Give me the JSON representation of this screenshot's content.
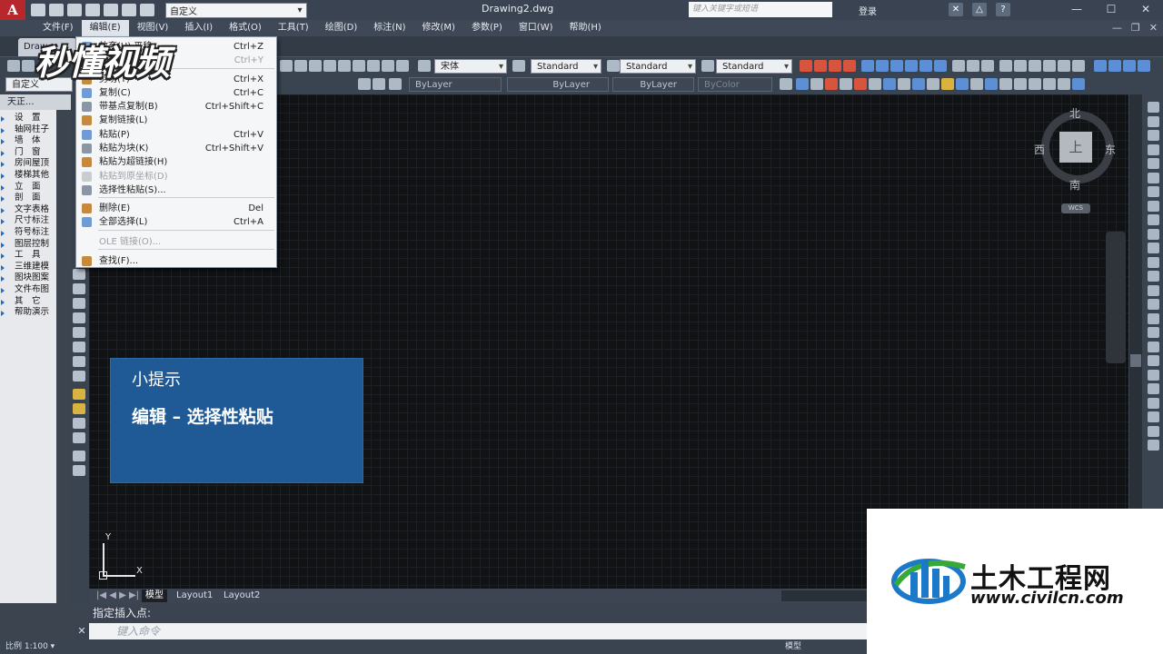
{
  "title_bar": {
    "app_logo": "A",
    "workspace": "自定义",
    "document_title": "Drawing2.dwg",
    "search_placeholder": "键入关键字或短语",
    "login_label": "登录",
    "win_min": "—",
    "win_max": "☐",
    "win_close": "✕",
    "mdi_min": "—",
    "mdi_max": "❐",
    "mdi_close": "✕"
  },
  "menubar": {
    "items": [
      "文件(F)",
      "编辑(E)",
      "视图(V)",
      "插入(I)",
      "格式(O)",
      "工具(T)",
      "绘图(D)",
      "标注(N)",
      "修改(M)",
      "参数(P)",
      "窗口(W)",
      "帮助(H)"
    ],
    "active_index": 1
  },
  "document_tab": "Draw",
  "toolbar": {
    "font_combo": "宋体",
    "text_style": "Standard",
    "dim_style": "Standard",
    "table_style": "Standard",
    "workspace_combo": "自定义",
    "layer_color": "ByLayer",
    "linetype": "ByLayer",
    "lineweight": "ByLayer",
    "plot_style": "ByColor"
  },
  "edit_menu": {
    "items": [
      {
        "label": "放弃(U) 平移",
        "key": "Ctrl+Z",
        "disabled": false,
        "icon": "undo-icon"
      },
      {
        "label": "重做(R)",
        "key": "Ctrl+Y",
        "disabled": true,
        "icon": "redo-icon"
      },
      {
        "label": "剪切(T)",
        "key": "Ctrl+X",
        "disabled": false,
        "icon": "scissors-icon"
      },
      {
        "label": "复制(C)",
        "key": "Ctrl+C",
        "disabled": false,
        "icon": "copy-icon"
      },
      {
        "label": "带基点复制(B)",
        "key": "Ctrl+Shift+C",
        "disabled": false,
        "icon": "copy-base-icon"
      },
      {
        "label": "复制链接(L)",
        "key": "",
        "disabled": false,
        "icon": "copy-link-icon"
      },
      {
        "label": "粘贴(P)",
        "key": "Ctrl+V",
        "disabled": false,
        "icon": "paste-icon"
      },
      {
        "label": "粘贴为块(K)",
        "key": "Ctrl+Shift+V",
        "disabled": false,
        "icon": "paste-block-icon"
      },
      {
        "label": "粘贴为超链接(H)",
        "key": "",
        "disabled": false,
        "icon": "paste-hyperlink-icon"
      },
      {
        "label": "粘贴到原坐标(D)",
        "key": "",
        "disabled": true,
        "icon": "paste-orig-icon"
      },
      {
        "label": "选择性粘贴(S)...",
        "key": "",
        "disabled": false,
        "icon": "paste-special-icon"
      },
      {
        "label": "删除(E)",
        "key": "Del",
        "disabled": false,
        "icon": "eraser-icon"
      },
      {
        "label": "全部选择(L)",
        "key": "Ctrl+A",
        "disabled": false,
        "icon": "select-all-icon"
      },
      {
        "label": "OLE 链接(O)...",
        "key": "",
        "disabled": true,
        "icon": ""
      },
      {
        "label": "查找(F)...",
        "key": "",
        "disabled": false,
        "icon": "find-icon"
      }
    ]
  },
  "left_panel": {
    "header": "天正...",
    "items": [
      "设　置",
      "轴网柱子",
      "墙　体",
      "门　窗",
      "房间屋顶",
      "楼梯其他",
      "立　面",
      "剖　面",
      "文字表格",
      "尺寸标注",
      "符号标注",
      "图层控制",
      "工　具",
      "三维建模",
      "图块图案",
      "文件布图",
      "其　它",
      "帮助演示"
    ]
  },
  "viewcube": {
    "north": "北",
    "south": "南",
    "east": "东",
    "west": "西",
    "face": "上",
    "wcs": "WCS"
  },
  "ucs": {
    "x": "X",
    "y": "Y"
  },
  "layout_tabs": [
    "模型",
    "Layout1",
    "Layout2"
  ],
  "command": {
    "history": "指定插入点:",
    "input_placeholder": "键入命令"
  },
  "status": {
    "scale": "比例 1:100 ▾",
    "model": "模型"
  },
  "watermark": {
    "left": "秒懂视频",
    "brand_name": "土木工程网",
    "brand_url": "www.civilcn.com"
  },
  "tip": {
    "title": "小提示",
    "body": "编辑 – 选择性粘贴"
  },
  "colors": {
    "accent_red": "#b8272b",
    "tip_blue": "#1f5a96",
    "brand_blue": "#1c78c8",
    "brand_green": "#38a838"
  }
}
